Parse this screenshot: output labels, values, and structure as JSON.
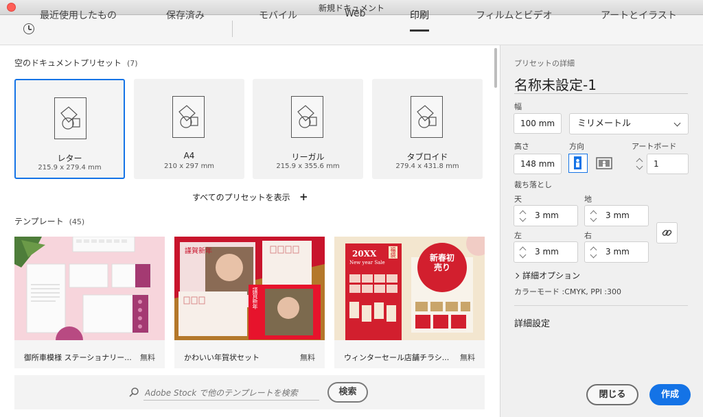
{
  "window": {
    "title": "新規ドキュメント"
  },
  "tabs": [
    {
      "label": "最近使用したもの"
    },
    {
      "label": "保存済み"
    },
    {
      "label": "モバイル"
    },
    {
      "label": "Web"
    },
    {
      "label": "印刷",
      "active": true
    },
    {
      "label": "フィルムとビデオ"
    },
    {
      "label": "アートとイラスト"
    }
  ],
  "blank_presets": {
    "label": "空のドキュメントプリセット",
    "count": "(7)",
    "items": [
      {
        "name": "レター",
        "size": "215.9 x 279.4 mm",
        "selected": true
      },
      {
        "name": "A4",
        "size": "210 x 297 mm"
      },
      {
        "name": "リーガル",
        "size": "215.9 x 355.6 mm"
      },
      {
        "name": "タブロイド",
        "size": "279.4 x 431.8 mm"
      }
    ],
    "show_all": "すべてのプリセットを表示"
  },
  "templates": {
    "label": "テンプレート",
    "count": "(45)",
    "items": [
      {
        "name": "御所車模様 ステーショナリー...",
        "price": "無料"
      },
      {
        "name": "かわいい年賀状セット",
        "price": "無料"
      },
      {
        "name": "ウィンターセール店舗チラシ...",
        "price": "無料"
      }
    ],
    "thumb_text": {
      "nenga1": "謹賀新年",
      "nenga2": "謹賀新年",
      "sale_year": "20XX",
      "sale_en": "New year Sale",
      "fukubukuro": "福袋",
      "hatsuuri": "新春初売り"
    }
  },
  "search": {
    "placeholder": "Adobe Stock で他のテンプレートを検索",
    "button": "検索"
  },
  "details": {
    "heading": "プリセットの詳細",
    "doc_name": "名称未設定-1",
    "width_label": "幅",
    "width_value": "100 mm",
    "unit": "ミリメートル",
    "height_label": "高さ",
    "height_value": "148 mm",
    "orientation_label": "方向",
    "artboard_label": "アートボード",
    "artboard_value": "1",
    "bleed_label": "裁ち落とし",
    "bleed_top_label": "天",
    "bleed_top": "3 mm",
    "bleed_bottom_label": "地",
    "bleed_bottom": "3 mm",
    "bleed_left_label": "左",
    "bleed_left": "3 mm",
    "bleed_right_label": "右",
    "bleed_right": "3 mm",
    "advanced_options": "詳細オプション",
    "color_mode": "カラーモード :CMYK, PPI :300",
    "more_settings": "詳細設定"
  },
  "actions": {
    "close": "閉じる",
    "create": "作成"
  },
  "colors": {
    "accent": "#1473e6",
    "pink": "#f2b8c6",
    "red": "#c8102e"
  },
  "icons": [
    "clock-icon",
    "document-shape-icon",
    "plus-icon",
    "search-icon",
    "chevron-down-icon",
    "portrait-icon",
    "landscape-icon",
    "link-icon",
    "chevron-right-icon"
  ]
}
